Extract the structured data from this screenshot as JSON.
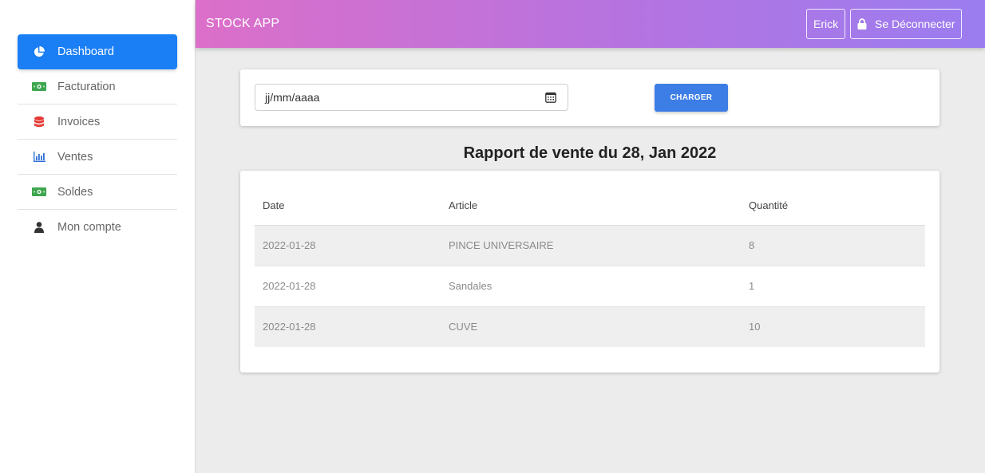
{
  "header": {
    "title": "STOCK APP",
    "user_label": "Erick",
    "logout_label": "Se Déconnecter"
  },
  "sidebar": {
    "items": [
      {
        "label": "Dashboard",
        "icon": "pie-chart-icon",
        "active": true
      },
      {
        "label": "Facturation",
        "icon": "money-icon"
      },
      {
        "label": "Invoices",
        "icon": "database-icon"
      },
      {
        "label": "Ventes",
        "icon": "bar-chart-icon"
      },
      {
        "label": "Soldes",
        "icon": "money-icon"
      },
      {
        "label": "Mon compte",
        "icon": "user-icon"
      }
    ]
  },
  "filter": {
    "date_placeholder": "jj/mm/aaaa",
    "load_label": "CHARGER"
  },
  "report": {
    "title": "Rapport de vente du 28, Jan 2022",
    "columns": [
      "Date",
      "Article",
      "Quantité"
    ],
    "rows": [
      [
        "2022-01-28",
        "PINCE UNIVERSAIRE",
        "8"
      ],
      [
        "2022-01-28",
        "Sandales",
        "1"
      ],
      [
        "2022-01-28",
        "CUVE",
        "10"
      ]
    ]
  },
  "colors": {
    "active_nav": "#1a7ef5",
    "button": "#3d7ee6",
    "header_gradient_start": "#dc6fc9",
    "header_gradient_end": "#9b7df0"
  }
}
